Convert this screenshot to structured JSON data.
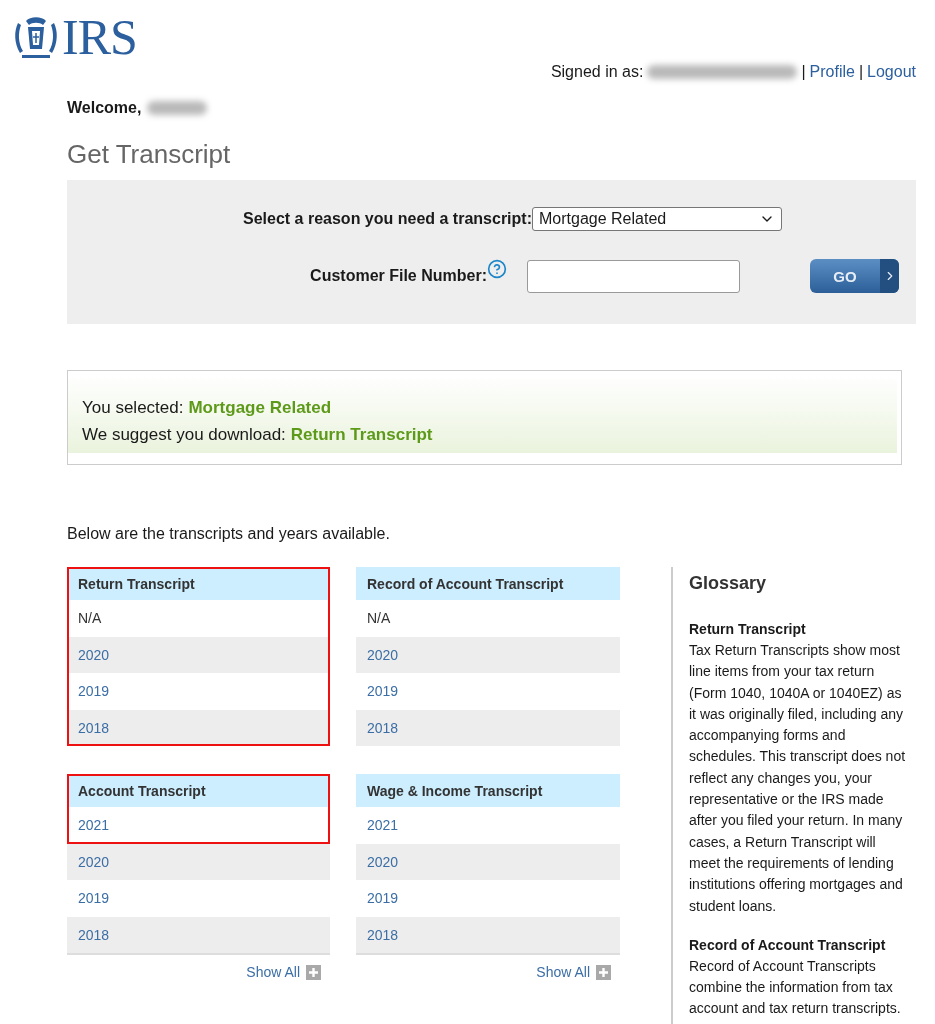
{
  "header": {
    "logo_text": "IRS",
    "signed_in_label": "Signed in as:",
    "signed_in_name_redacted": true,
    "separator_1": "|",
    "profile_link": "Profile",
    "separator_2": "|",
    "logout_link": "Logout",
    "welcome": "Welcome,",
    "welcome_name_redacted": true
  },
  "title": "Get Transcript",
  "form": {
    "reason_label": "Select a reason you need a transcript:",
    "reason_value": "Mortgage Related",
    "file_number_label": "Customer File Number:",
    "go_button": "GO"
  },
  "suggestion": {
    "selected_label": "You selected:",
    "selected_value": "Mortgage Related",
    "suggest_label": "We suggest you download:",
    "suggest_value": "Return Transcript"
  },
  "intro": "Below are the transcripts and years available.",
  "panels": [
    {
      "title": "Return Transcript",
      "highlighted": true,
      "rows": [
        {
          "text": "N/A",
          "kind": "plain",
          "highlighted": true
        },
        {
          "text": "2020",
          "kind": "link",
          "highlighted": true
        },
        {
          "text": "2019",
          "kind": "link",
          "highlighted": true
        },
        {
          "text": "2018",
          "kind": "link",
          "highlighted": true
        }
      ]
    },
    {
      "title": "Record of Account Transcript",
      "highlighted": false,
      "rows": [
        {
          "text": "N/A",
          "kind": "plain",
          "highlighted": false
        },
        {
          "text": "2020",
          "kind": "link",
          "highlighted": false
        },
        {
          "text": "2019",
          "kind": "link",
          "highlighted": false
        },
        {
          "text": "2018",
          "kind": "link",
          "highlighted": false
        }
      ]
    },
    {
      "title": "Account Transcript",
      "highlighted": true,
      "show_all": "Show All",
      "rows": [
        {
          "text": "2021",
          "kind": "link",
          "highlighted": true
        },
        {
          "text": "2020",
          "kind": "link",
          "highlighted": false
        },
        {
          "text": "2019",
          "kind": "link",
          "highlighted": false
        },
        {
          "text": "2018",
          "kind": "link",
          "highlighted": false
        }
      ]
    },
    {
      "title": "Wage & Income Transcript",
      "highlighted": false,
      "show_all": "Show All",
      "rows": [
        {
          "text": "2021",
          "kind": "link",
          "highlighted": false
        },
        {
          "text": "2020",
          "kind": "link",
          "highlighted": false
        },
        {
          "text": "2019",
          "kind": "link",
          "highlighted": false
        },
        {
          "text": "2018",
          "kind": "link",
          "highlighted": false
        }
      ]
    }
  ],
  "glossary": {
    "title": "Glossary",
    "entries": [
      {
        "term": "Return Transcript",
        "definition": "Tax Return Transcripts show most line items from your tax return (Form 1040, 1040A or 1040EZ) as it was originally filed, including any accompanying forms and schedules. This transcript does not reflect any changes you, your representative or the IRS made after you filed your return. In many cases, a Return Transcript will meet the requirements of lending institutions offering mortgages and student loans."
      },
      {
        "term": "Record of Account Transcript",
        "definition": "Record of Account Transcripts combine the information from tax account and tax return transcripts."
      }
    ]
  }
}
